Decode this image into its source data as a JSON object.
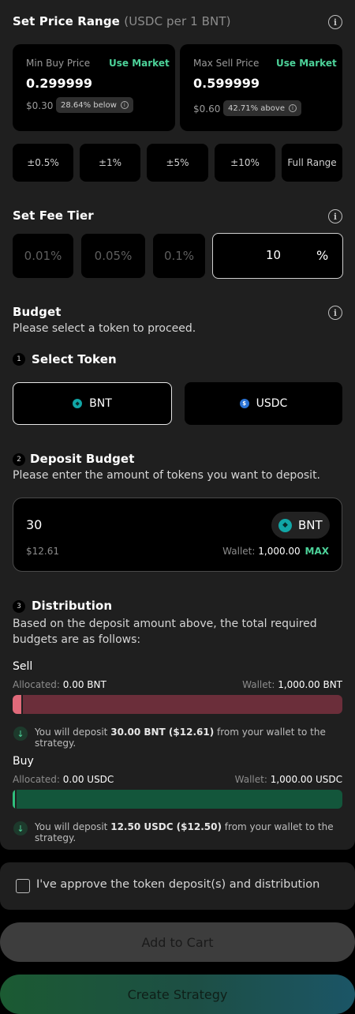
{
  "price_range": {
    "title": "Set Price Range",
    "subtitle": "(USDC per 1 BNT)",
    "min": {
      "label": "Min Buy Price",
      "use_market": "Use Market",
      "value": "0.299999",
      "usd": "$0.30",
      "badge": "28.64% below"
    },
    "max": {
      "label": "Max Sell Price",
      "use_market": "Use Market",
      "value": "0.599999",
      "usd": "$0.60",
      "badge": "42.71% above"
    },
    "presets": [
      "±0.5%",
      "±1%",
      "±5%",
      "±10%",
      "Full Range"
    ]
  },
  "fee_tier": {
    "title": "Set Fee Tier",
    "options": [
      "0.01%",
      "0.05%",
      "0.1%"
    ],
    "custom_value": "10",
    "custom_unit": "%"
  },
  "budget": {
    "title": "Budget",
    "description": "Please select a token to proceed.",
    "step1": {
      "num": "1",
      "title": "Select Token"
    },
    "tokens": [
      {
        "symbol": "BNT",
        "selected": true
      },
      {
        "symbol": "USDC",
        "selected": false
      }
    ],
    "step2": {
      "num": "2",
      "title": "Deposit Budget",
      "description": "Please enter the amount of tokens you want to deposit."
    },
    "deposit": {
      "amount": "30",
      "token": "BNT",
      "usd": "$12.61",
      "wallet_label": "Wallet:",
      "wallet_value": "1,000.00",
      "max_label": "MAX"
    },
    "step3": {
      "num": "3",
      "title": "Distribution",
      "description": "Based on the deposit amount above, the total required budgets are as follows:"
    },
    "sell": {
      "title": "Sell",
      "allocated_label": "Allocated:",
      "allocated_value": "0.00 BNT",
      "wallet_label": "Wallet:",
      "wallet_value": "1,000.00 BNT",
      "fill_fraction": 0.03,
      "note_pre": "You will deposit",
      "note_amount": "30.00 BNT ($12.61)",
      "note_post": "from your wallet to the strategy."
    },
    "buy": {
      "title": "Buy",
      "allocated_label": "Allocated:",
      "allocated_value": "0.00 USDC",
      "wallet_label": "Wallet:",
      "wallet_value": "1,000.00 USDC",
      "fill_fraction": 0.0125,
      "note_pre": "You will deposit",
      "note_amount": "12.50 USDC ($12.50)",
      "note_post": "from your wallet to the strategy."
    }
  },
  "approve": {
    "label": "I've approve the token deposit(s) and distribution"
  },
  "actions": {
    "add_to_cart": "Add to Cart",
    "create_strategy": "Create Strategy"
  },
  "colors": {
    "accent_green": "#4dd39a",
    "sell_bar": "#6b2e3a",
    "sell_fill": "#e06a7a",
    "buy_bar": "#13563b",
    "buy_fill": "#2fbf7d"
  }
}
